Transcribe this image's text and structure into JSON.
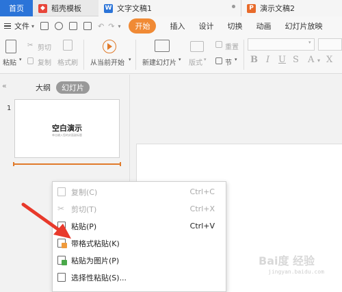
{
  "tabs": {
    "home": "首页",
    "template": "稻壳模板",
    "doc": "文字文稿1",
    "ppt": "演示文稿2"
  },
  "menubar": {
    "file": "文件",
    "start": "开始",
    "items": [
      "插入",
      "设计",
      "切换",
      "动画",
      "幻灯片放映"
    ]
  },
  "ribbon": {
    "paste": "粘贴",
    "cut": "剪切",
    "copy": "复制",
    "format_painter": "格式刷",
    "play_from_current": "从当前开始",
    "new_slide": "新建幻灯片",
    "layout": "版式",
    "reset": "重置",
    "section": "节"
  },
  "panel": {
    "outline_tab": "大纲",
    "slides_tab": "幻灯片",
    "slide_number": "1",
    "thumb_title": "空白演示",
    "thumb_subtitle": "单击输入您的封面副标题"
  },
  "context_menu": [
    {
      "label": "复制(C)",
      "shortcut": "Ctrl+C",
      "enabled": false
    },
    {
      "label": "剪切(T)",
      "shortcut": "Ctrl+X",
      "enabled": false
    },
    {
      "label": "粘贴(P)",
      "shortcut": "Ctrl+V",
      "enabled": true
    },
    {
      "label": "带格式粘贴(K)",
      "shortcut": "",
      "enabled": true
    },
    {
      "label": "粘贴为图片(P)",
      "shortcut": "",
      "enabled": true
    },
    {
      "label": "选择性粘贴(S)...",
      "shortcut": "",
      "enabled": true
    }
  ],
  "watermark": {
    "brand": "Bai度 经验",
    "url": "jingyan.baidu.com"
  },
  "colors": {
    "accent": "#f08a35",
    "home_tab": "#2b74d8",
    "arrow": "#e8392b"
  }
}
